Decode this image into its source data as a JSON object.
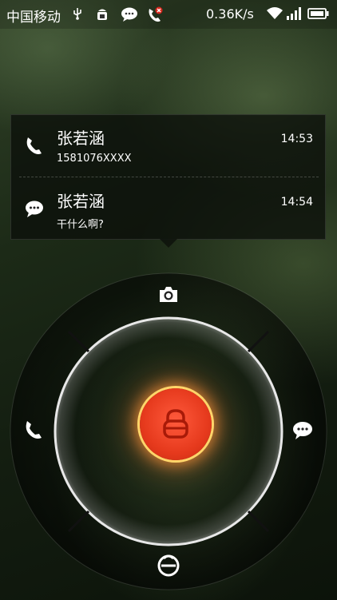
{
  "status_bar": {
    "carrier": "中国移动",
    "network_speed": "0.36K/s",
    "icons": [
      "usb-icon",
      "android-debug-icon",
      "message-icon",
      "missed-call-icon",
      "wifi-icon",
      "signal-icon",
      "battery-icon"
    ]
  },
  "notifications": [
    {
      "type": "call",
      "icon": "phone-icon",
      "name": "张若涵",
      "detail": "1581076XXXX",
      "time": "14:53"
    },
    {
      "type": "message",
      "icon": "message-bubble-icon",
      "name": "张若涵",
      "detail": "干什么啊?",
      "time": "14:54"
    }
  ],
  "lock_ring": {
    "actions": [
      "camera-icon",
      "phone-icon",
      "message-icon",
      "unlock-icon"
    ],
    "center": "lock-icon"
  },
  "colors": {
    "accent": "#e63a1d",
    "glow": "#ffd56a"
  }
}
